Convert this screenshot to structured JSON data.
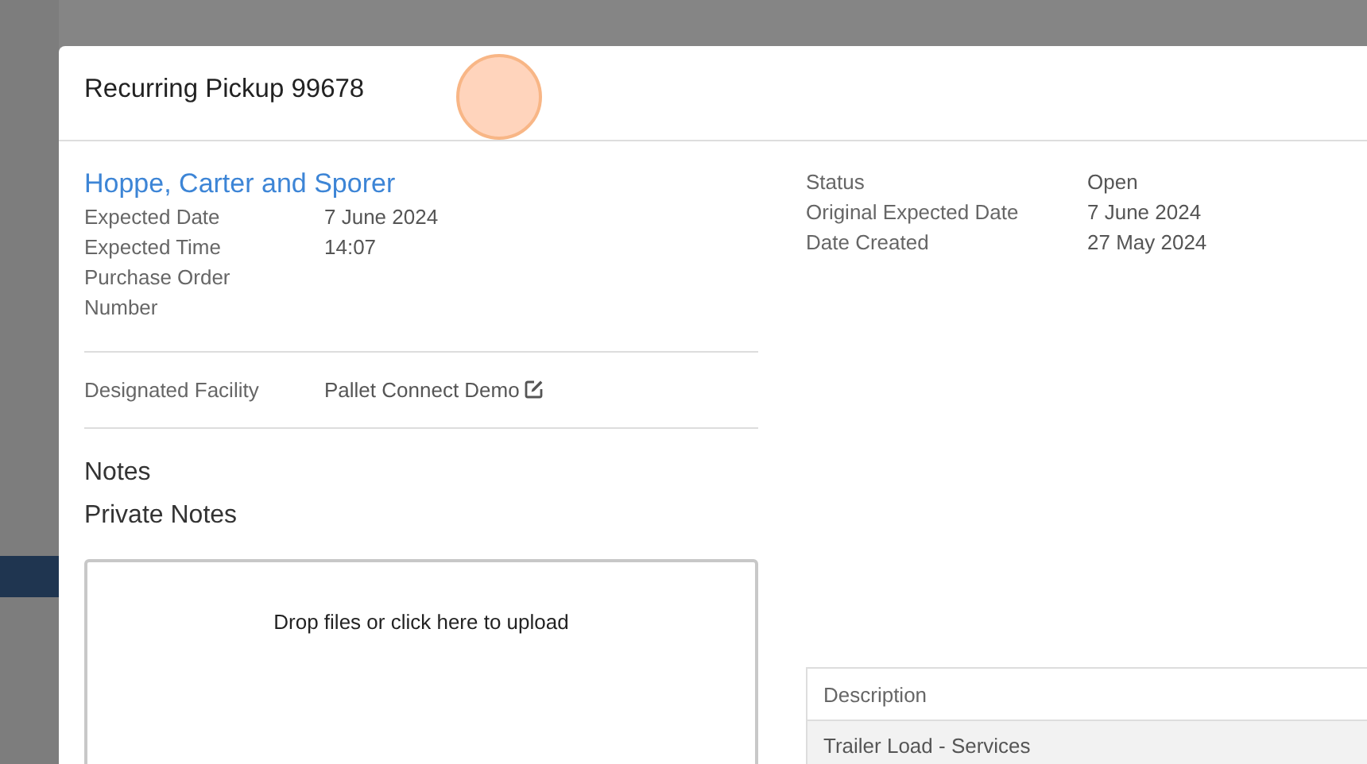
{
  "dialog": {
    "title": "Recurring Pickup 99678"
  },
  "customer": {
    "name": "Hoppe, Carter and Sporer"
  },
  "details": [
    {
      "label": "Expected Date",
      "value": "7 June 2024"
    },
    {
      "label": "Expected Time",
      "value": "14:07"
    },
    {
      "label": "Purchase Order Number"
    }
  ],
  "facility": {
    "label": "Designated Facility",
    "value": "Pallet Connect Demo"
  },
  "notes_heading": "Notes",
  "private_notes_heading": "Private Notes",
  "upload": {
    "prompt": "Drop files or click here to upload"
  },
  "summary": [
    {
      "label": "Status",
      "value": "Open"
    },
    {
      "label": "Original Expected Date",
      "value": "7 June 2024"
    },
    {
      "label": "Date Created",
      "value": "27 May 2024"
    }
  ],
  "table": {
    "columns": [
      "Description"
    ],
    "rows": [
      [
        "Trailer Load - Services"
      ]
    ]
  }
}
